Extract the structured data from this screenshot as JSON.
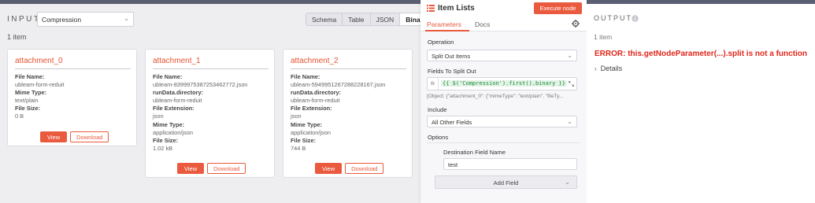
{
  "input": {
    "label": "INPUT",
    "node_select": "Compression",
    "view_tabs": [
      "Schema",
      "Table",
      "JSON",
      "Binary"
    ],
    "active_tab": "Binary",
    "item_count": "1 item",
    "cards": [
      {
        "title": "attachment_0",
        "fields": [
          {
            "label": "File Name:",
            "value": "ubleam-form-reduit"
          },
          {
            "label": "Mime Type:",
            "value": "text/plain"
          },
          {
            "label": "File Size:",
            "value": "0 B"
          }
        ],
        "view_label": "View",
        "download_label": "Download"
      },
      {
        "title": "attachment_1",
        "fields": [
          {
            "label": "File Name:",
            "value": "ubleam-8399975387253462772.json"
          },
          {
            "label": "runData.directory:",
            "value": "ubleam-form-reduit"
          },
          {
            "label": "File Extension:",
            "value": "json"
          },
          {
            "label": "Mime Type:",
            "value": "application/json"
          },
          {
            "label": "File Size:",
            "value": "1.02 kB"
          }
        ],
        "view_label": "View",
        "download_label": "Download"
      },
      {
        "title": "attachment_2",
        "fields": [
          {
            "label": "File Name:",
            "value": "ubleam-5949951267288228167.json"
          },
          {
            "label": "runData.directory:",
            "value": "ubleam-form-reduit"
          },
          {
            "label": "File Extension:",
            "value": "json"
          },
          {
            "label": "Mime Type:",
            "value": "application/json"
          },
          {
            "label": "File Size:",
            "value": "744 B"
          }
        ],
        "view_label": "View",
        "download_label": "Download"
      }
    ]
  },
  "node": {
    "title": "Item Lists",
    "execute_label": "Execute node",
    "tabs": {
      "parameters": "Parameters",
      "docs": "Docs"
    },
    "operation_label": "Operation",
    "operation_value": "Split Out Items",
    "fields_label": "Fields To Split Out",
    "fields_expression": "{{ $('Compression').first().binary }}",
    "fields_preview": "[Object: {\"attachment_0\": {\"mimeType\": \"text/plain\", \"fileTy...",
    "include_label": "Include",
    "include_value": "All Other Fields",
    "options_label": "Options",
    "dest_label": "Destination Field Name",
    "dest_value": "test",
    "add_field_label": "Add Field"
  },
  "output": {
    "label": "OUTPUT",
    "item_count": "1 item",
    "error": "ERROR: this.getNodeParameter(...).split is not a function",
    "details_label": "Details"
  },
  "colors": {
    "accent": "#ea5a3f",
    "error": "#e0261b",
    "expression": "#1a8c3a"
  }
}
